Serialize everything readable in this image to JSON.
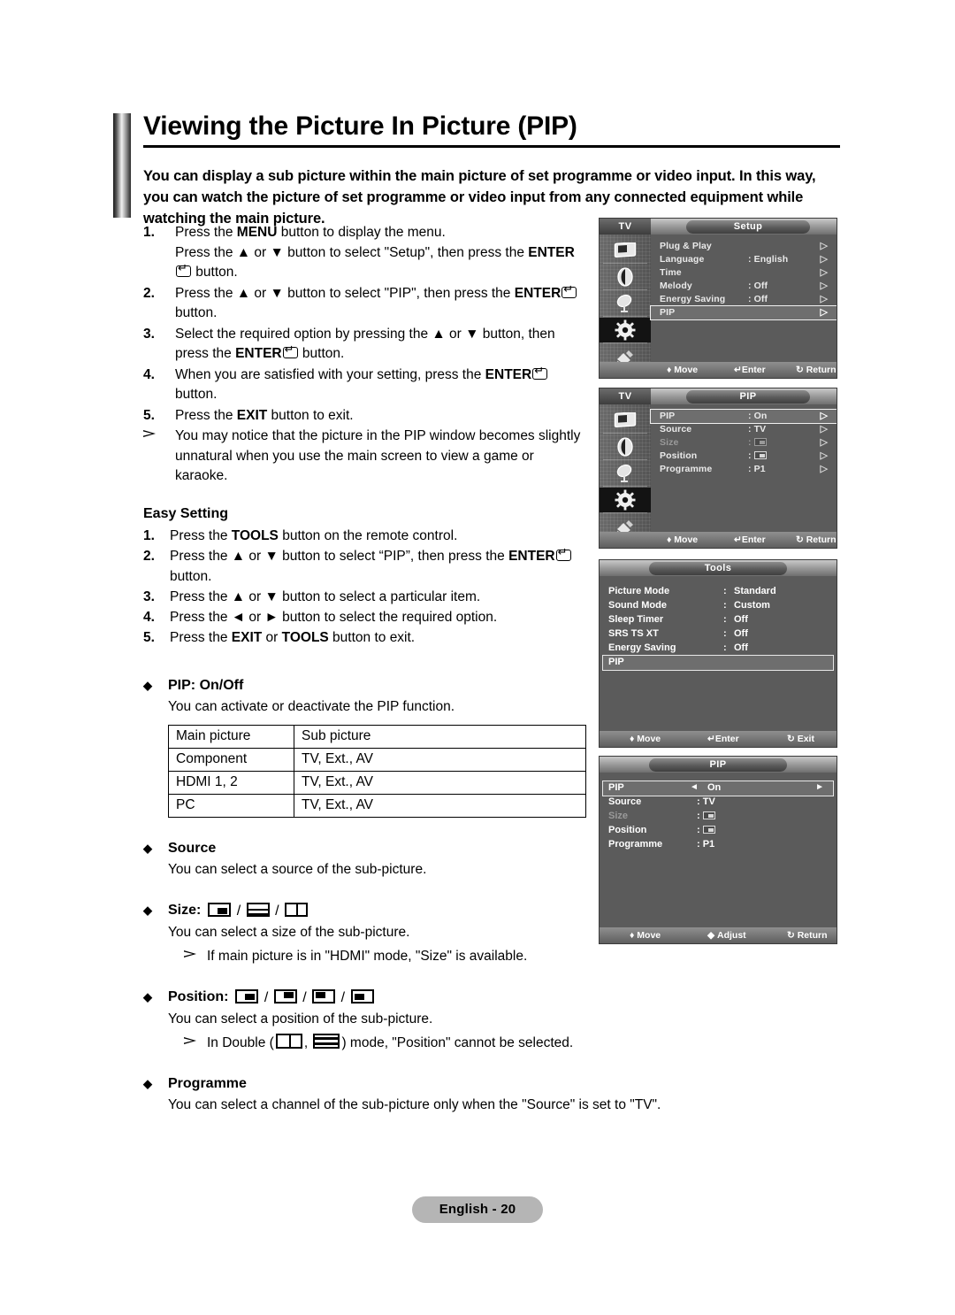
{
  "header": {
    "title": "Viewing the Picture In Picture (PIP)",
    "intro": "You can display a sub picture within the main picture of set programme or video input. In this way, you can watch the picture of set programme or video input from any connected equipment while watching the main picture."
  },
  "steps": [
    {
      "num": "1.",
      "line1_a": "Press the ",
      "bold1": "MENU",
      "line1_b": " button to display the menu.",
      "line2_a": "Press the ▲ or ▼ button to select \"Setup\", then press the ",
      "bold2": "ENTER",
      "line2_b": " button."
    },
    {
      "num": "2.",
      "line1_a": "Press the ▲ or ▼ button to select \"PIP\", then press the ",
      "bold1": "ENTER",
      "line1_b": " button."
    },
    {
      "num": "3.",
      "line1_a": "Select the required option by pressing the ▲ or ▼ button, then press the ",
      "bold1": "ENTER",
      "line1_b": " button."
    },
    {
      "num": "4.",
      "line1_a": "When you are satisfied with your setting, press the ",
      "bold1": "ENTER",
      "line1_b": " button."
    },
    {
      "num": "5.",
      "line1_a": "Press the ",
      "bold1": "EXIT",
      "line1_b": " button to exit."
    }
  ],
  "step_note": "You may notice that the picture in the PIP window becomes slightly unnatural when you use the main screen to view a game or karaoke.",
  "easy": {
    "heading": "Easy Setting",
    "items": [
      {
        "num": "1.",
        "a": "Press the ",
        "b": "TOOLS",
        "c": " button on the remote control."
      },
      {
        "num": "2.",
        "a": "Press the ▲ or ▼ button to select “PIP”, then press the ",
        "b": "ENTER",
        "c": " button."
      },
      {
        "num": "3.",
        "a": "Press the ▲ or ▼ button to select a particular item.",
        "b": "",
        "c": ""
      },
      {
        "num": "4.",
        "a": "Press the ◄ or ► button to select the required option.",
        "b": "",
        "c": ""
      },
      {
        "num": "5.",
        "a": "Press the ",
        "b": "EXIT",
        "c": " or ",
        "d": "TOOLS",
        "e": " button to exit."
      }
    ]
  },
  "sections": {
    "pip_onoff": {
      "title": "PIP: On/Off",
      "body": "You can activate or deactivate the PIP function.",
      "table": {
        "headers": [
          "Main picture",
          "Sub picture"
        ],
        "rows": [
          [
            "Component",
            "TV, Ext., AV"
          ],
          [
            "HDMI 1, 2",
            "TV, Ext., AV"
          ],
          [
            "PC",
            "TV, Ext., AV"
          ]
        ]
      }
    },
    "source": {
      "title": "Source",
      "body": "You can select a source of the sub-picture."
    },
    "size": {
      "title": "Size:",
      "body": "You can select a size of the sub-picture.",
      "note": "If main picture is in \"HDMI\" mode, \"Size\" is available.",
      "icons": [
        "pip-small",
        "double-window-horizontal",
        "double-window-vertical"
      ]
    },
    "position": {
      "title": "Position:",
      "body": "You can select a position of the sub-picture.",
      "note_before": "In Double (",
      "note_mid": ", ",
      "note_after": ") mode, \"Position\" cannot be selected.",
      "icons": [
        "bottom-right",
        "top-right",
        "top-left",
        "bottom-left"
      ]
    },
    "programme": {
      "title": "Programme",
      "body": "You can select a channel of the sub-picture only when the \"Source\" is set to \"TV\"."
    }
  },
  "osd": {
    "setup": {
      "tv_label": "TV",
      "tab": "Setup",
      "rows": [
        {
          "label": "Plug & Play",
          "value": "",
          "caret": "▷"
        },
        {
          "label": "Language",
          "value": ": English",
          "caret": "▷"
        },
        {
          "label": "Time",
          "value": "",
          "caret": "▷"
        },
        {
          "label": "Melody",
          "value": ": Off",
          "caret": "▷"
        },
        {
          "label": "Energy Saving",
          "value": ": Off",
          "caret": "▷"
        },
        {
          "label": "PIP",
          "value": "",
          "caret": "▷"
        }
      ],
      "footer": {
        "move": "Move",
        "enter": "Enter",
        "return": "Return"
      }
    },
    "pip_menu": {
      "tv_label": "TV",
      "tab": "PIP",
      "rows": [
        {
          "label": "PIP",
          "value": ": On",
          "caret": "▷"
        },
        {
          "label": "Source",
          "value": ": TV",
          "caret": "▷"
        },
        {
          "label": "Size",
          "value": ":",
          "caret": "▷"
        },
        {
          "label": "Position",
          "value": ":",
          "caret": "▷"
        },
        {
          "label": "Programme",
          "value": ": P1",
          "caret": "▷"
        }
      ],
      "footer": {
        "move": "Move",
        "enter": "Enter",
        "return": "Return"
      }
    },
    "tools": {
      "tab": "Tools",
      "rows": [
        {
          "label": "Picture Mode",
          "value": "Standard"
        },
        {
          "label": "Sound Mode",
          "value": "Custom"
        },
        {
          "label": "Sleep Timer",
          "value": "Off"
        },
        {
          "label": "SRS TS XT",
          "value": "Off"
        },
        {
          "label": "Energy Saving",
          "value": "Off"
        },
        {
          "label": "PIP",
          "value": ""
        }
      ],
      "footer": {
        "move": "Move",
        "enter": "Enter",
        "exit": "Exit"
      }
    },
    "pip_adjust": {
      "tab": "PIP",
      "rows": [
        {
          "label": "PIP",
          "value": "On"
        },
        {
          "label": "Source",
          "value": ": TV"
        },
        {
          "label": "Size",
          "value": ":"
        },
        {
          "label": "Position",
          "value": ":"
        },
        {
          "label": "Programme",
          "value": ": P1"
        }
      ],
      "footer": {
        "move": "Move",
        "adjust": "Adjust",
        "return": "Return"
      }
    }
  },
  "footer": {
    "page_label": "English - 20"
  }
}
